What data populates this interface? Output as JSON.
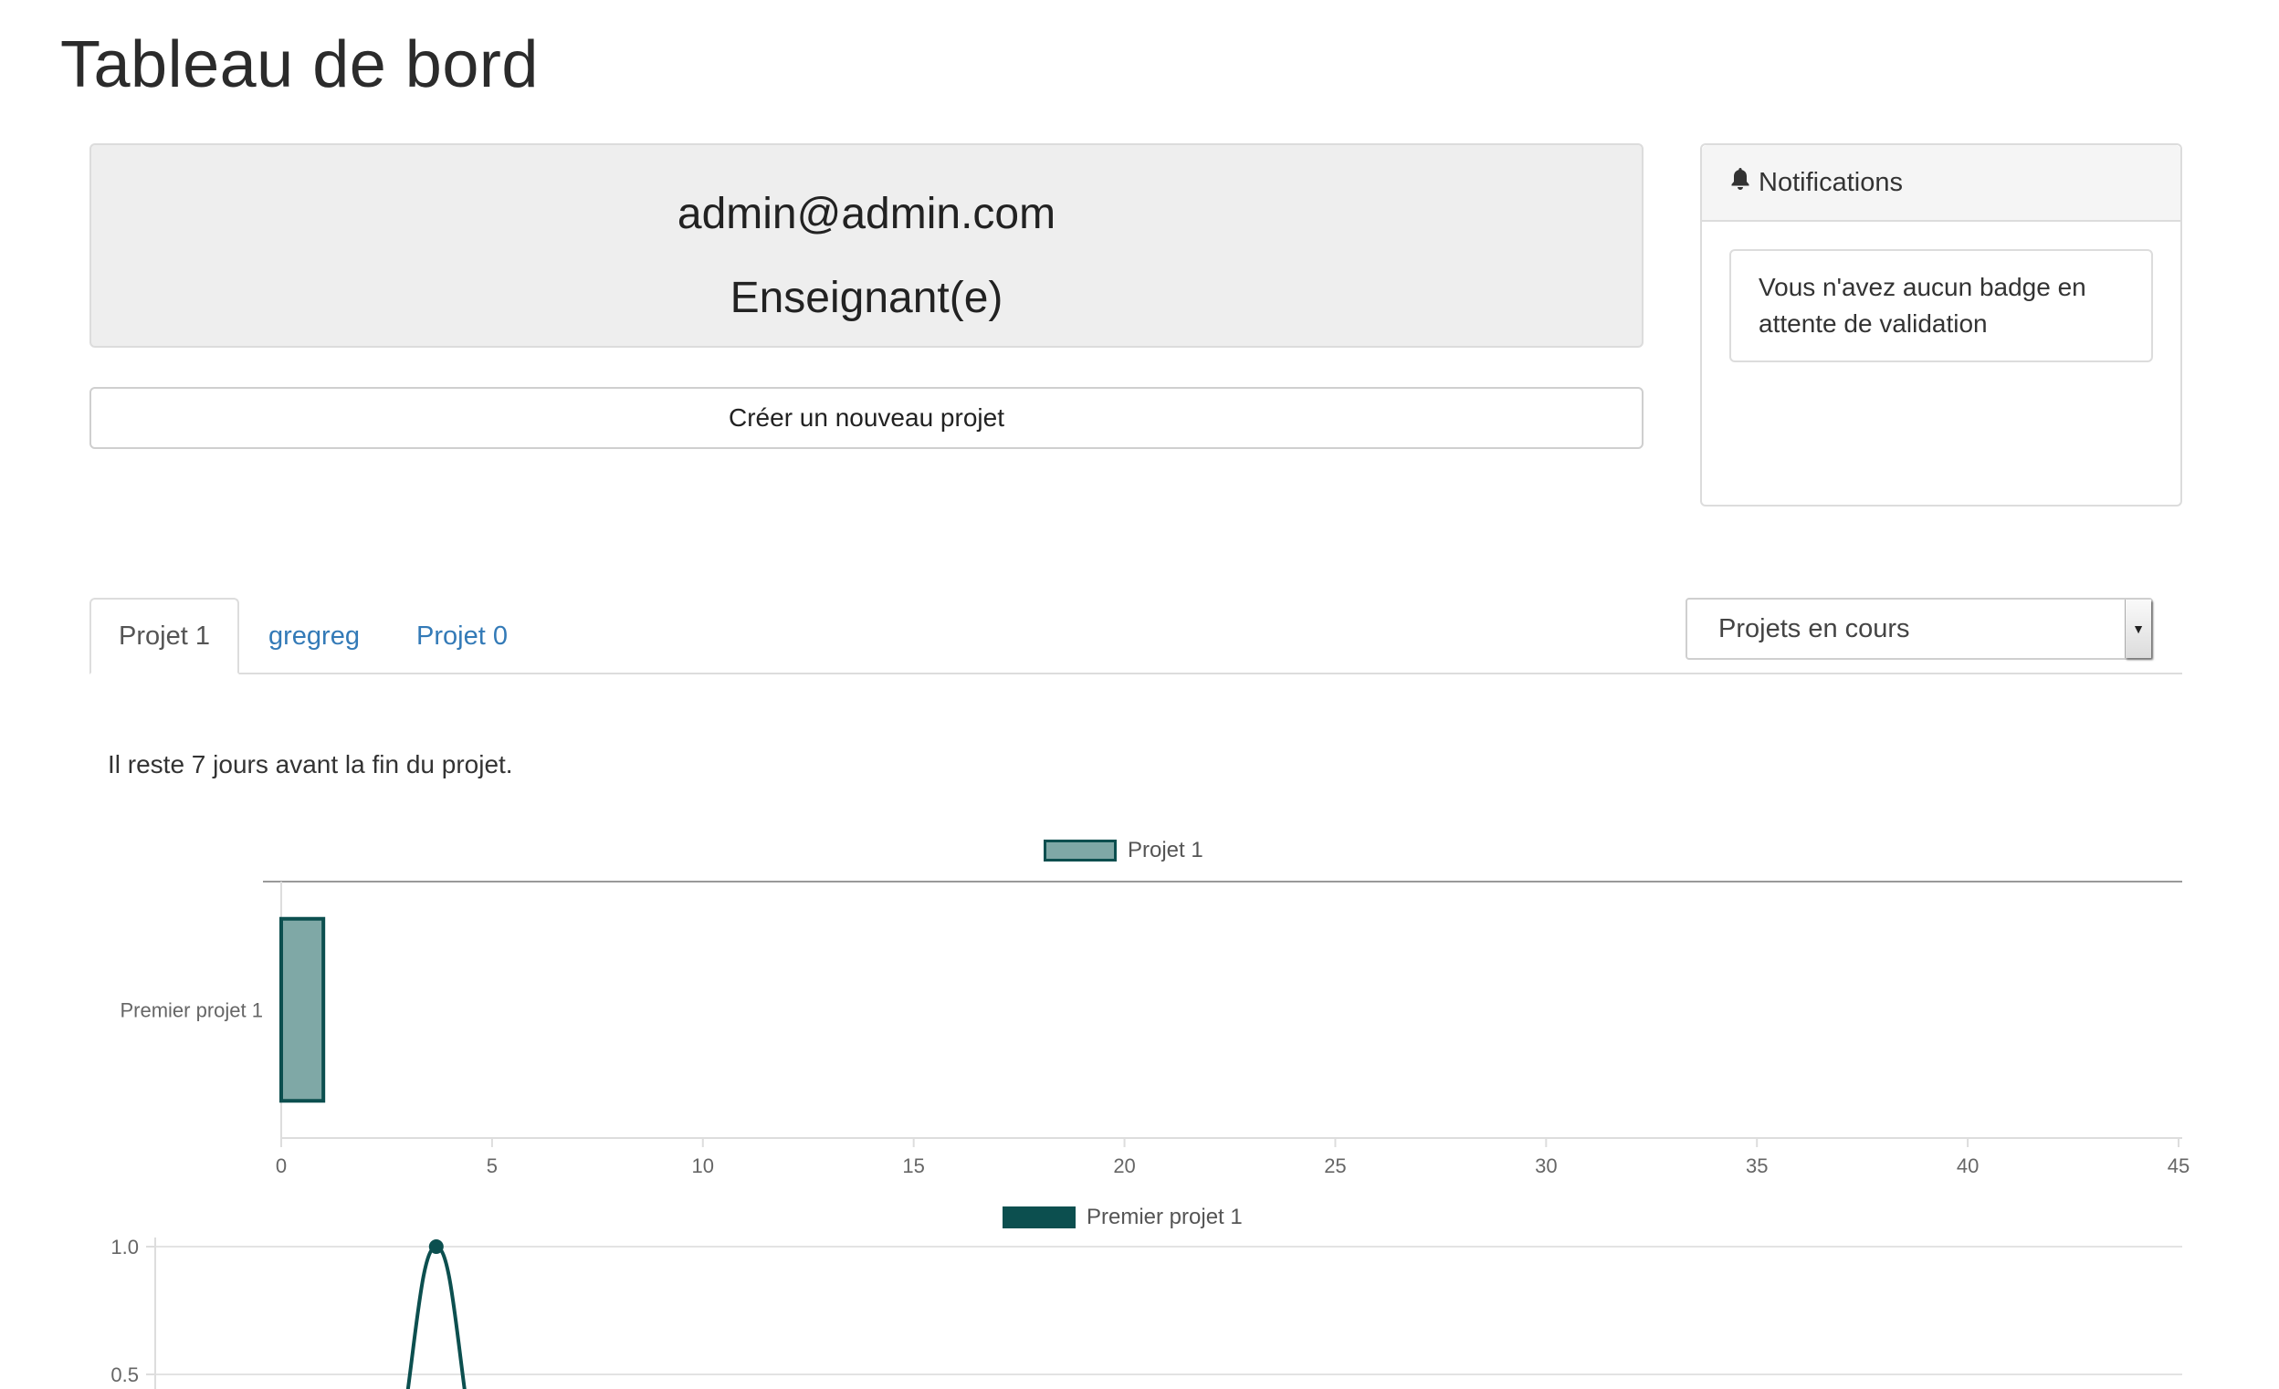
{
  "page": {
    "title": "Tableau de bord"
  },
  "profile": {
    "email": "admin@admin.com",
    "role": "Enseignant(e)"
  },
  "actions": {
    "create_project": "Créer un nouveau projet"
  },
  "notifications": {
    "header": "Notifications",
    "message": "Vous n'avez aucun badge en attente de validation"
  },
  "tabs": [
    {
      "label": "Projet 1",
      "active": true
    },
    {
      "label": "gregreg",
      "active": false
    },
    {
      "label": "Projet 0",
      "active": false
    }
  ],
  "filter": {
    "selected": "Projets en cours"
  },
  "info": "Il reste 7 jours avant la fin du projet.",
  "colors": {
    "bar_fill": "#7fa8a6",
    "bar_stroke": "#0c4f4f",
    "line": "#0c4f4f",
    "link": "#337ab7"
  },
  "chart_data": [
    {
      "type": "bar",
      "orientation": "horizontal",
      "legend": [
        "Projet 1"
      ],
      "categories": [
        "Premier projet 1"
      ],
      "series": [
        {
          "name": "Projet 1",
          "values": [
            1
          ]
        }
      ],
      "xlim": [
        0,
        45
      ],
      "xticks": [
        "0",
        "5",
        "10",
        "15",
        "20",
        "25",
        "30",
        "35",
        "40",
        "45"
      ]
    },
    {
      "type": "line",
      "legend": [
        "Premier projet 1"
      ],
      "series": [
        {
          "name": "Premier projet 1",
          "peak_x_fraction": 0.14,
          "peak_y": 1.0
        }
      ],
      "yticks": [
        "1.0",
        "0.5"
      ]
    }
  ]
}
